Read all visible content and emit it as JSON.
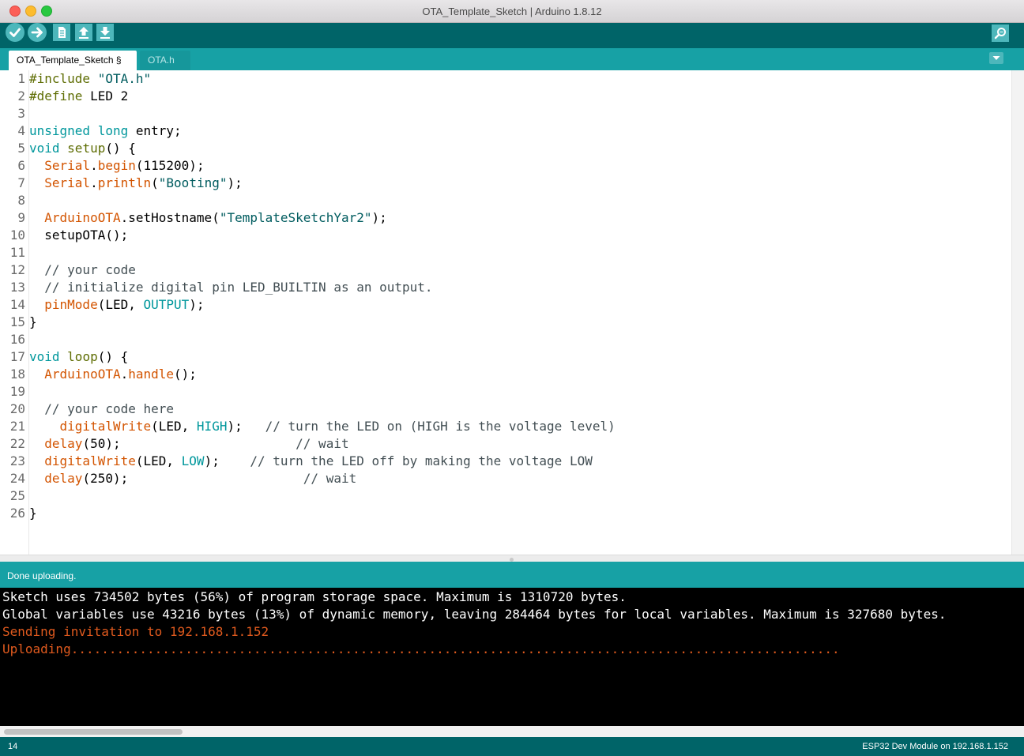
{
  "window": {
    "title": "OTA_Template_Sketch | Arduino 1.8.12"
  },
  "toolbar": {
    "buttons": [
      {
        "name": "verify",
        "icon": "check-icon"
      },
      {
        "name": "upload",
        "icon": "arrow-right-icon"
      },
      {
        "name": "new",
        "icon": "new-file-icon"
      },
      {
        "name": "open",
        "icon": "arrow-up-icon"
      },
      {
        "name": "save",
        "icon": "arrow-down-icon"
      },
      {
        "name": "serial-monitor",
        "icon": "magnifier-icon"
      }
    ]
  },
  "tabs": [
    {
      "label": "OTA_Template_Sketch §",
      "active": true
    },
    {
      "label": "OTA.h",
      "active": false
    }
  ],
  "editor": {
    "line_numbers": [
      "1",
      "2",
      "3",
      "4",
      "5",
      "6",
      "7",
      "8",
      "9",
      "10",
      "11",
      "12",
      "13",
      "14",
      "15",
      "16",
      "17",
      "18",
      "19",
      "20",
      "21",
      "22",
      "23",
      "24",
      "25",
      "26"
    ],
    "lines": [
      [
        {
          "c": "pp",
          "t": "#include"
        },
        {
          "c": "tx",
          "t": " "
        },
        {
          "c": "str",
          "t": "\"OTA.h\""
        }
      ],
      [
        {
          "c": "pp",
          "t": "#define"
        },
        {
          "c": "tx",
          "t": " LED 2"
        }
      ],
      [],
      [
        {
          "c": "kw",
          "t": "unsigned"
        },
        {
          "c": "tx",
          "t": " "
        },
        {
          "c": "kw",
          "t": "long"
        },
        {
          "c": "tx",
          "t": " entry;"
        }
      ],
      [
        {
          "c": "kw",
          "t": "void"
        },
        {
          "c": "tx",
          "t": " "
        },
        {
          "c": "pp",
          "t": "setup"
        },
        {
          "c": "tx",
          "t": "() {"
        }
      ],
      [
        {
          "c": "tx",
          "t": "  "
        },
        {
          "c": "fn",
          "t": "Serial"
        },
        {
          "c": "tx",
          "t": "."
        },
        {
          "c": "fn",
          "t": "begin"
        },
        {
          "c": "tx",
          "t": "(115200);"
        }
      ],
      [
        {
          "c": "tx",
          "t": "  "
        },
        {
          "c": "fn",
          "t": "Serial"
        },
        {
          "c": "tx",
          "t": "."
        },
        {
          "c": "fn",
          "t": "println"
        },
        {
          "c": "tx",
          "t": "("
        },
        {
          "c": "str",
          "t": "\"Booting\""
        },
        {
          "c": "tx",
          "t": ");"
        }
      ],
      [],
      [
        {
          "c": "tx",
          "t": "  "
        },
        {
          "c": "fn",
          "t": "ArduinoOTA"
        },
        {
          "c": "tx",
          "t": ".setHostname("
        },
        {
          "c": "str",
          "t": "\"TemplateSketchYar2\""
        },
        {
          "c": "tx",
          "t": ");"
        }
      ],
      [
        {
          "c": "tx",
          "t": "  setupOTA();"
        }
      ],
      [],
      [
        {
          "c": "cm",
          "t": "  // your code"
        }
      ],
      [
        {
          "c": "cm",
          "t": "  // initialize digital pin LED_BUILTIN as an output."
        }
      ],
      [
        {
          "c": "tx",
          "t": "  "
        },
        {
          "c": "fn",
          "t": "pinMode"
        },
        {
          "c": "tx",
          "t": "(LED, "
        },
        {
          "c": "kw",
          "t": "OUTPUT"
        },
        {
          "c": "tx",
          "t": ");"
        }
      ],
      [
        {
          "c": "tx",
          "t": "}"
        }
      ],
      [],
      [
        {
          "c": "kw",
          "t": "void"
        },
        {
          "c": "tx",
          "t": " "
        },
        {
          "c": "pp",
          "t": "loop"
        },
        {
          "c": "tx",
          "t": "() {"
        }
      ],
      [
        {
          "c": "tx",
          "t": "  "
        },
        {
          "c": "fn",
          "t": "ArduinoOTA"
        },
        {
          "c": "tx",
          "t": "."
        },
        {
          "c": "fn",
          "t": "handle"
        },
        {
          "c": "tx",
          "t": "();"
        }
      ],
      [],
      [
        {
          "c": "cm",
          "t": "  // your code here"
        }
      ],
      [
        {
          "c": "tx",
          "t": "    "
        },
        {
          "c": "fn",
          "t": "digitalWrite"
        },
        {
          "c": "tx",
          "t": "(LED, "
        },
        {
          "c": "kw",
          "t": "HIGH"
        },
        {
          "c": "tx",
          "t": ");   "
        },
        {
          "c": "cm",
          "t": "// turn the LED on (HIGH is the voltage level)"
        }
      ],
      [
        {
          "c": "tx",
          "t": "  "
        },
        {
          "c": "fn",
          "t": "delay"
        },
        {
          "c": "tx",
          "t": "(50);                       "
        },
        {
          "c": "cm",
          "t": "// wait"
        }
      ],
      [
        {
          "c": "tx",
          "t": "  "
        },
        {
          "c": "fn",
          "t": "digitalWrite"
        },
        {
          "c": "tx",
          "t": "(LED, "
        },
        {
          "c": "kw",
          "t": "LOW"
        },
        {
          "c": "tx",
          "t": ");    "
        },
        {
          "c": "cm",
          "t": "// turn the LED off by making the voltage LOW"
        }
      ],
      [
        {
          "c": "tx",
          "t": "  "
        },
        {
          "c": "fn",
          "t": "delay"
        },
        {
          "c": "tx",
          "t": "(250);                       "
        },
        {
          "c": "cm",
          "t": "// wait"
        }
      ],
      [],
      [
        {
          "c": "tx",
          "t": "}"
        }
      ]
    ]
  },
  "status": {
    "message": "Done uploading."
  },
  "console": {
    "lines": [
      {
        "text": "Sketch uses 734502 bytes (56%) of program storage space. Maximum is 1310720 bytes.",
        "color": "white"
      },
      {
        "text": "Global variables use 43216 bytes (13%) of dynamic memory, leaving 284464 bytes for local variables. Maximum is 327680 bytes.",
        "color": "orange"
      },
      {
        "text": "Sending invitation to 192.168.1.152",
        "color": "orange"
      },
      {
        "text": "Uploading.....................................................................................................",
        "color": "orange"
      }
    ]
  },
  "footer": {
    "line": "14",
    "board": "ESP32 Dev Module on 192.168.1.152"
  },
  "colors": {
    "toolbar": "#006468",
    "tabbar": "#17a1a5",
    "button": "#4db7bb",
    "console_bg": "#000000",
    "console_orange": "#e05a1e"
  }
}
